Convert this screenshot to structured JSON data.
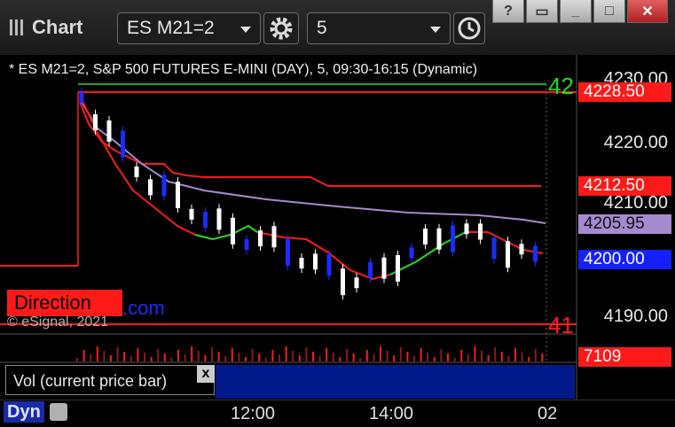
{
  "titlebar": {
    "title": "Chart",
    "symbol_combo": "ES M21=2",
    "interval_combo": "5",
    "help": "?",
    "window_buttons": [
      "?",
      "▭",
      "_",
      "□",
      "✕"
    ]
  },
  "chart": {
    "header": "* ES M21=2, S&P 500 FUTURES E-MINI (DAY), 5, 09:30-16:15 (Dynamic)",
    "y_ticks": [
      "4230.00",
      "4220.00",
      "4210.00",
      "4190.00"
    ],
    "price_tags": {
      "high_line": "4228.50",
      "upper_line": "4212.50",
      "vwap": "4205.95",
      "last": "4200.00",
      "volume": "7109"
    },
    "markers": {
      "top": "42",
      "bottom": "41"
    },
    "watermark": "© eSignal, 2021",
    "brand_box": "Direction",
    "brand_suffix": ".com",
    "x_ticks": [
      "12:00",
      "14:00",
      "02"
    ],
    "colors": {
      "up_candle": "#ffffff",
      "down_candle": "#1a2cff",
      "red_line": "#ff1a1a",
      "purple_line": "#a58ad0",
      "green_line": "#22dd22"
    }
  },
  "volume_panel": {
    "label": "Vol (current price bar)",
    "close": "x"
  },
  "bottom": {
    "dyn": "Dyn"
  }
}
